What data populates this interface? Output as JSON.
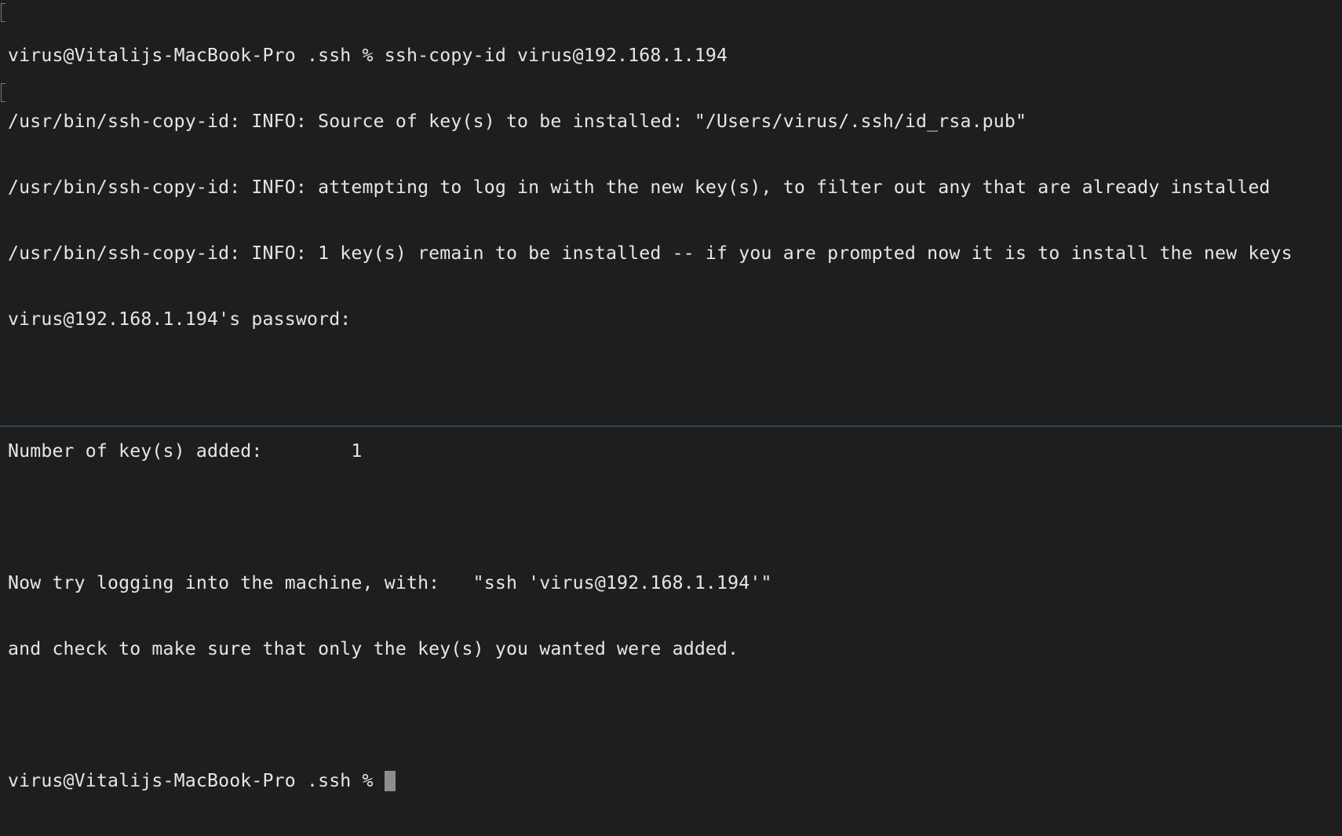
{
  "terminal": {
    "lines": [
      "virus@Vitalijs-MacBook-Pro .ssh % ssh-copy-id virus@192.168.1.194",
      "/usr/bin/ssh-copy-id: INFO: Source of key(s) to be installed: \"/Users/virus/.ssh/id_rsa.pub\"",
      "/usr/bin/ssh-copy-id: INFO: attempting to log in with the new key(s), to filter out any that are already installed",
      "/usr/bin/ssh-copy-id: INFO: 1 key(s) remain to be installed -- if you are prompted now it is to install the new keys",
      "virus@192.168.1.194's password:",
      "",
      "Number of key(s) added:        1",
      "",
      "Now try logging into the machine, with:   \"ssh 'virus@192.168.1.194'\"",
      "and check to make sure that only the key(s) you wanted were added.",
      ""
    ],
    "prompt": "virus@Vitalijs-MacBook-Pro .ssh % "
  }
}
